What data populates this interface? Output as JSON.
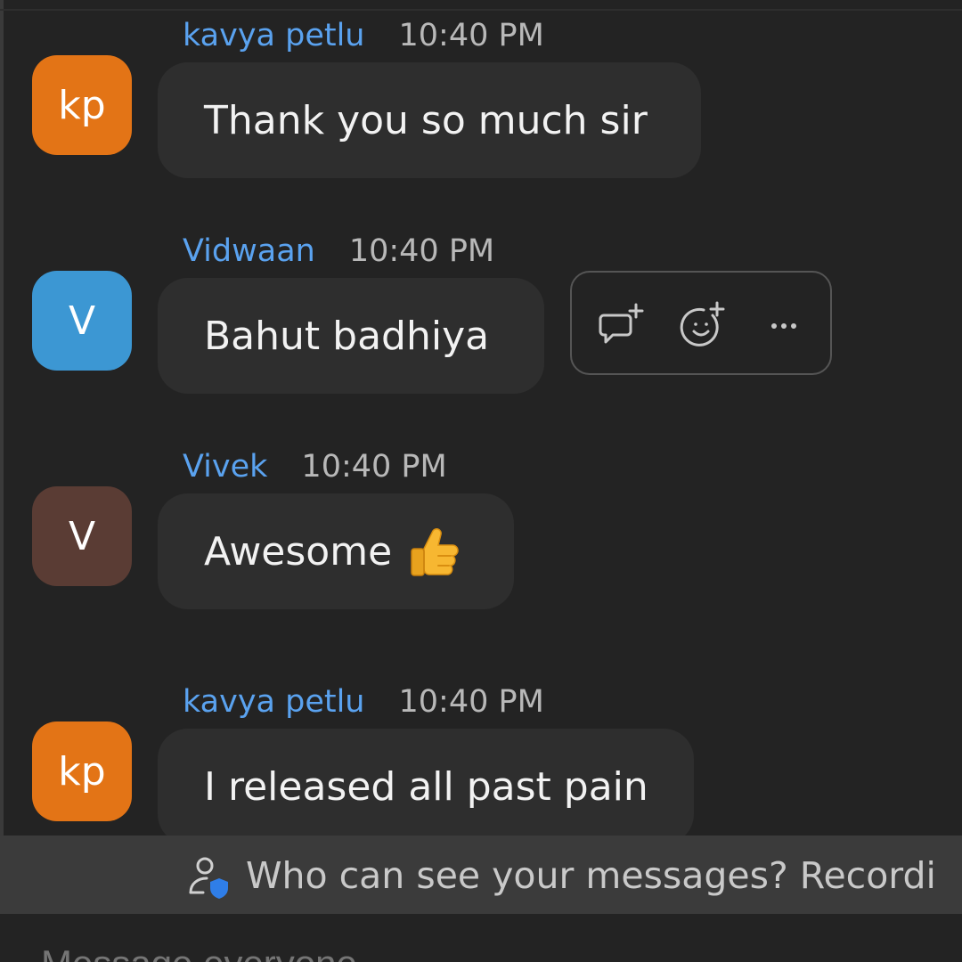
{
  "messages": [
    {
      "sender": "kavya petlu",
      "time": "10:40 PM",
      "initials": "kp",
      "avatar_color": "#e37416",
      "text": "Thank you so much sir"
    },
    {
      "sender": "Vidwaan",
      "time": "10:40 PM",
      "initials": "V",
      "avatar_color": "#3c97d3",
      "text": "Bahut badhiya"
    },
    {
      "sender": "Vivek",
      "time": "10:40 PM",
      "initials": "V",
      "avatar_color": "#5a3c34",
      "text": "Awesome"
    },
    {
      "sender": "kavya petlu",
      "time": "10:40 PM",
      "initials": "kp",
      "avatar_color": "#e37416",
      "text": "I released all past pain"
    }
  ],
  "message_actions": {
    "icons": [
      "reply-in-thread-icon",
      "add-reaction-icon",
      "more-options-icon"
    ]
  },
  "notice": {
    "icon": "privacy-person-shield-icon",
    "text": "Who can see your messages? Recordi"
  },
  "composer": {
    "placeholder": "Message everyone"
  },
  "colors": {
    "background": "#232323",
    "bubble": "#2e2e2e",
    "sender_name": "#5aa2ef",
    "notice_bar": "#3b3b3b"
  }
}
